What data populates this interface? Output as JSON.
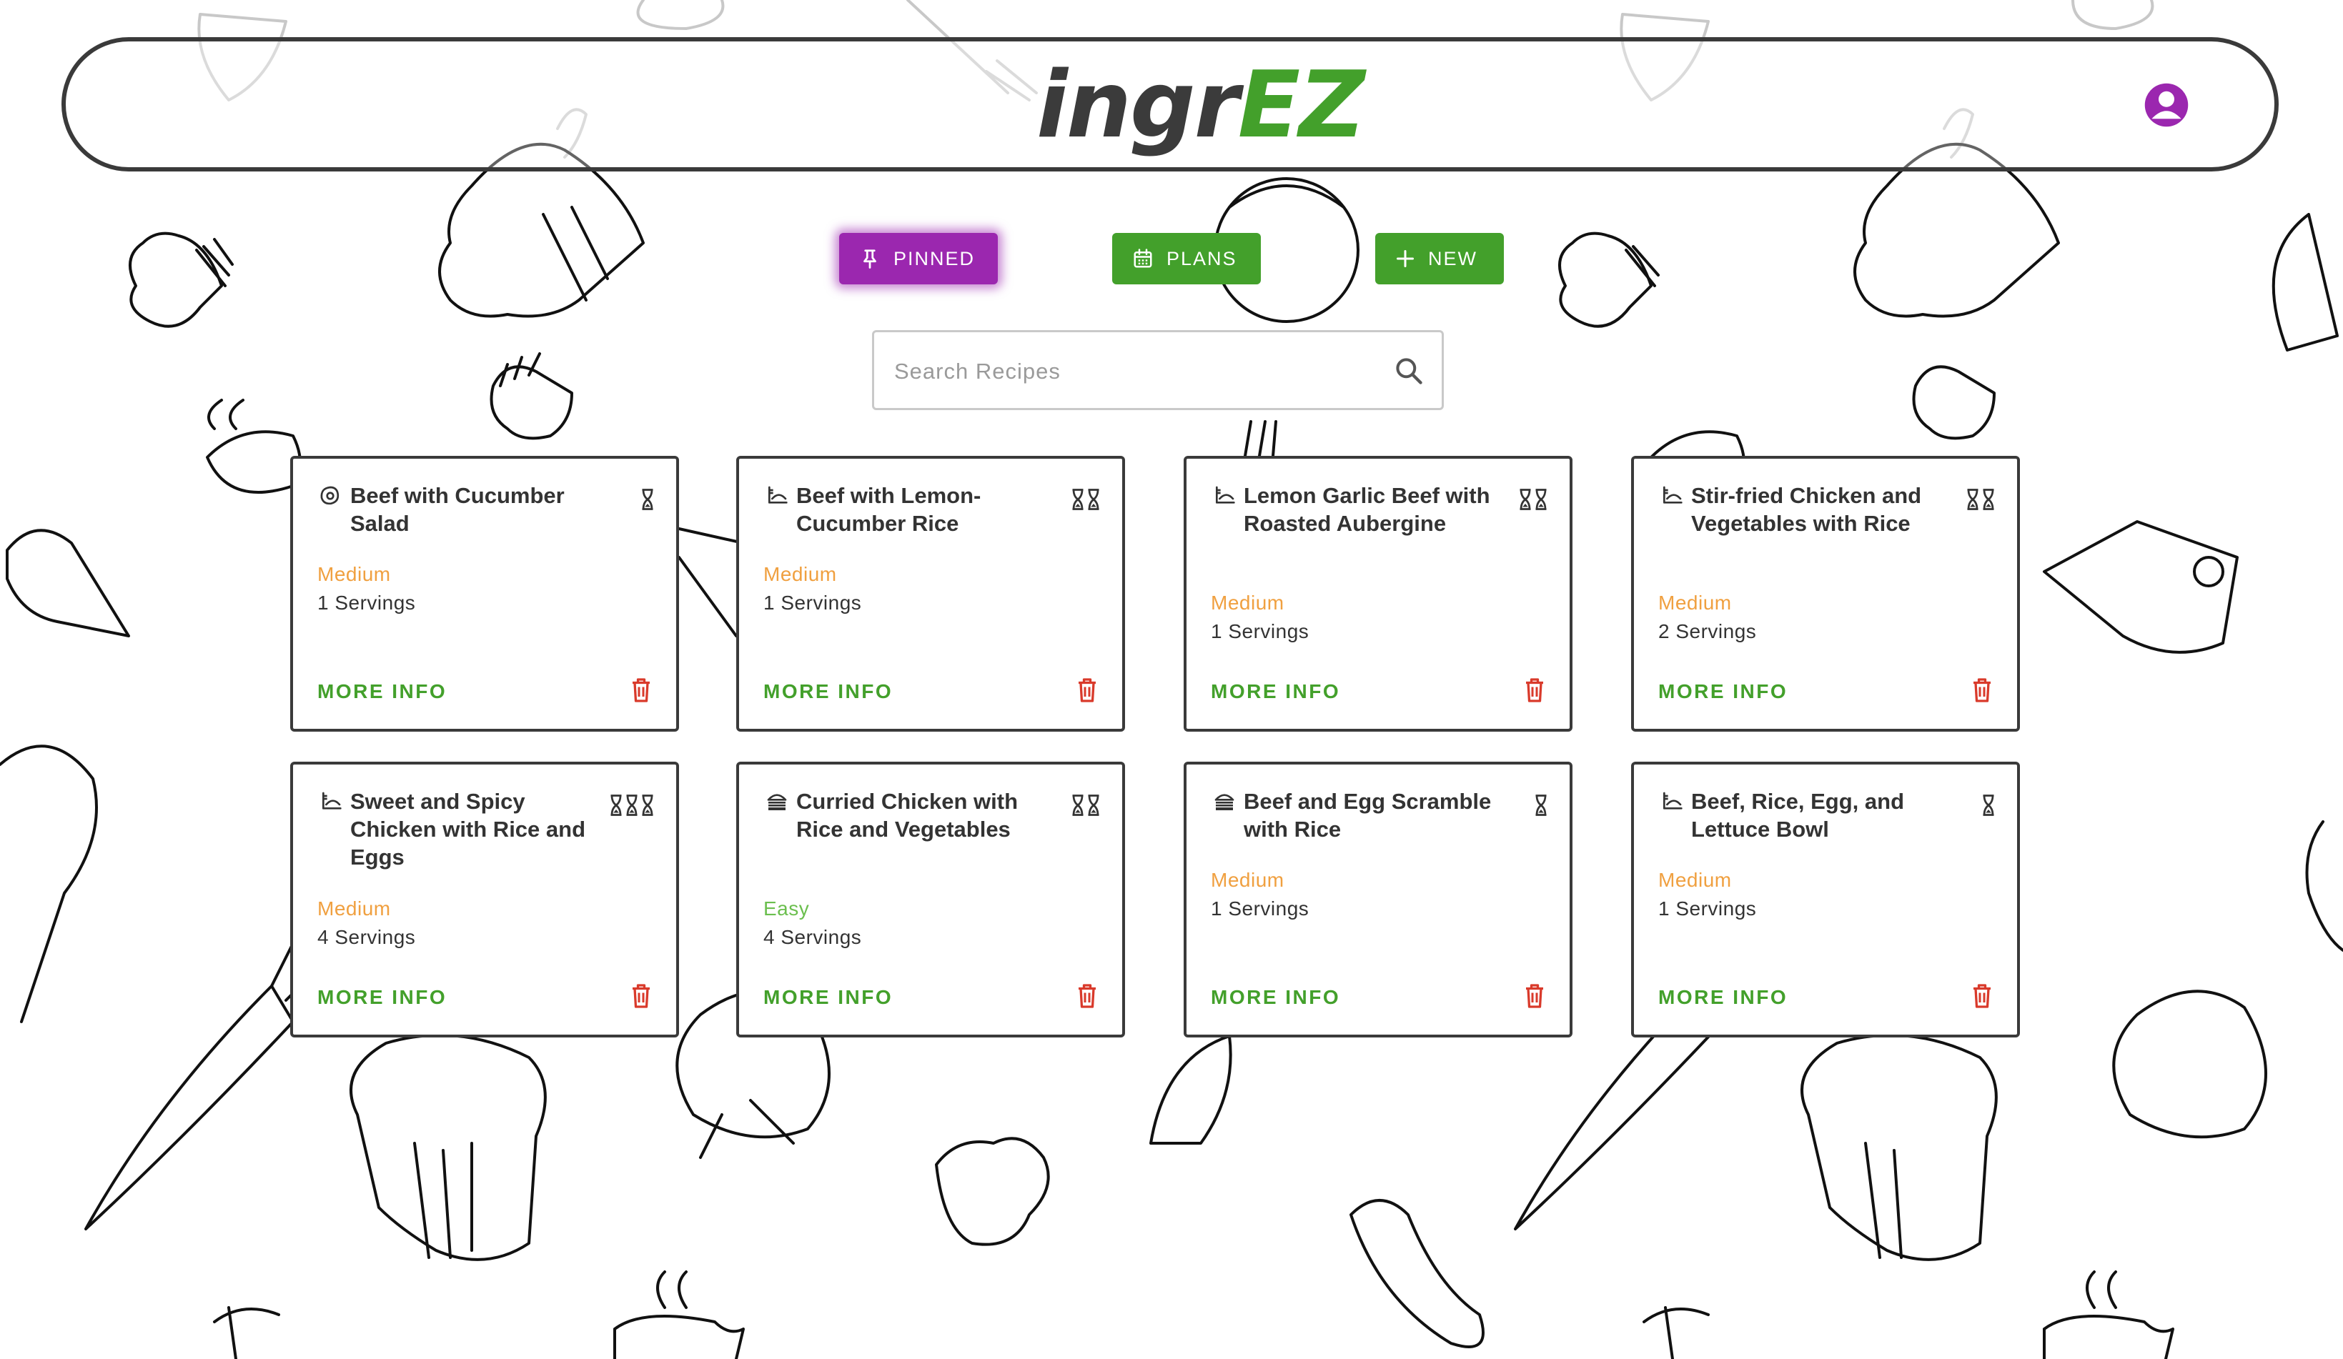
{
  "header": {
    "logo_dark": "ingr",
    "logo_green": "EZ",
    "avatar_icon": "account-circle-icon"
  },
  "toolbar": {
    "pinned_label": "PINNED",
    "pinned_icon": "pin-icon",
    "plans_label": "PLANS",
    "plans_icon": "calendar-icon",
    "new_label": "NEW",
    "new_icon": "plus-icon"
  },
  "search": {
    "placeholder": "Search Recipes",
    "value": "",
    "icon": "search-icon"
  },
  "colors": {
    "brand_green": "#43a02b",
    "pinned_purple": "#9b27af",
    "medium_orange": "#f0a040",
    "easy_green": "#6bbf4e",
    "delete_red": "#d93a2b"
  },
  "recipes": [
    {
      "title": "Beef with Cucumber Salad",
      "type_icon": "fried-egg-icon",
      "time_level": 1,
      "difficulty": "Medium",
      "servings": "1 Servings",
      "more_info": "MORE INFO"
    },
    {
      "title": "Beef with Lemon-Cucumber Rice",
      "type_icon": "dinner-plate-icon",
      "time_level": 2,
      "difficulty": "Medium",
      "servings": "1 Servings",
      "more_info": "MORE INFO"
    },
    {
      "title": "Lemon Garlic Beef with Roasted Aubergine",
      "type_icon": "dinner-plate-icon",
      "time_level": 2,
      "difficulty": "Medium",
      "servings": "1 Servings",
      "more_info": "MORE INFO"
    },
    {
      "title": "Stir-fried Chicken and Vegetables with Rice",
      "type_icon": "dinner-plate-icon",
      "time_level": 2,
      "difficulty": "Medium",
      "servings": "2 Servings",
      "more_info": "MORE INFO"
    },
    {
      "title": "Sweet and Spicy Chicken with Rice and Eggs",
      "type_icon": "dinner-plate-icon",
      "time_level": 3,
      "difficulty": "Medium",
      "servings": "4 Servings",
      "more_info": "MORE INFO"
    },
    {
      "title": "Curried Chicken with Rice and Vegetables",
      "type_icon": "burger-icon",
      "time_level": 2,
      "difficulty": "Easy",
      "servings": "4 Servings",
      "more_info": "MORE INFO"
    },
    {
      "title": "Beef and Egg Scramble with Rice",
      "type_icon": "burger-icon",
      "time_level": 1,
      "difficulty": "Medium",
      "servings": "1 Servings",
      "more_info": "MORE INFO"
    },
    {
      "title": "Beef, Rice, Egg, and Lettuce Bowl",
      "type_icon": "dinner-plate-icon",
      "time_level": 1,
      "difficulty": "Medium",
      "servings": "1 Servings",
      "more_info": "MORE INFO"
    }
  ]
}
